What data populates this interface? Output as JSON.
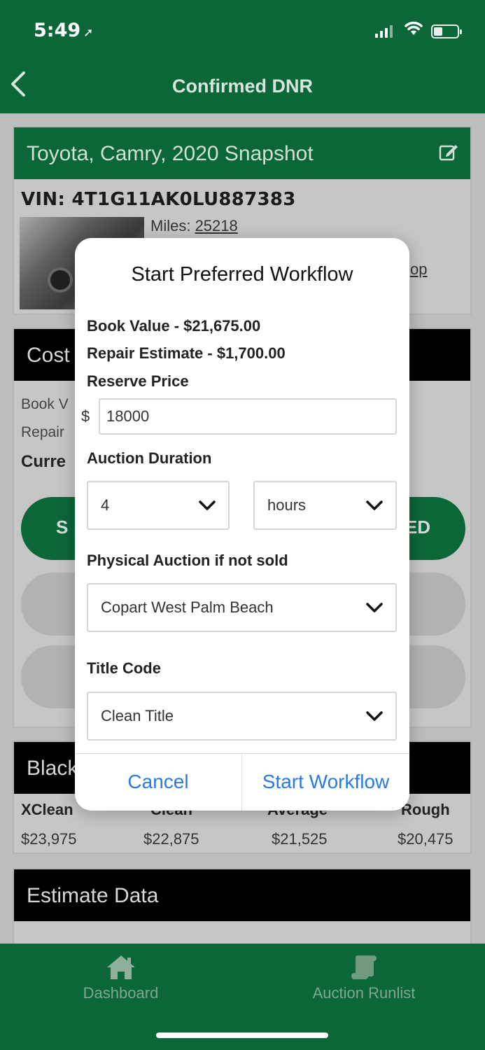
{
  "status": {
    "time": "5:49",
    "location_glyph": "➚"
  },
  "nav": {
    "title": "Confirmed DNR",
    "back_glyph": "‹"
  },
  "snapshot": {
    "title": "Toyota, Camry, 2020 Snapshot",
    "vin": "VIN: 4T1G11AK0LU887383",
    "miles_label": "Miles: ",
    "miles_value": "25218",
    "link_fragment": "op"
  },
  "cost": {
    "header": "Cost",
    "row1": "Book V",
    "row2": "Repair",
    "row3": "Curre",
    "left_button": "S",
    "right_button": "ED"
  },
  "blackbook": {
    "header": "Black",
    "columns": [
      {
        "label": "XClean",
        "value": "$23,975"
      },
      {
        "label": "Clean",
        "value": "$22,875"
      },
      {
        "label": "Average",
        "value": "$21,525"
      },
      {
        "label": "Rough",
        "value": "$20,475"
      }
    ]
  },
  "estimate": {
    "header": "Estimate Data"
  },
  "modal": {
    "title": "Start Preferred Workflow",
    "book_value": "Book Value - $21,675.00",
    "repair_estimate": "Repair Estimate - $1,700.00",
    "reserve_label": "Reserve Price",
    "currency": "$",
    "reserve_value": "18000",
    "duration_label": "Auction Duration",
    "duration_value": "4",
    "duration_unit": "hours",
    "physical_label": "Physical Auction if not sold",
    "physical_value": "Copart West Palm Beach",
    "title_code_label": "Title Code",
    "title_code_value": "Clean Title",
    "cancel": "Cancel",
    "start": "Start Workflow"
  },
  "tabs": [
    {
      "label": "Dashboard",
      "icon": "home-icon"
    },
    {
      "label": "Auction Runlist",
      "icon": "scroll-icon"
    }
  ],
  "colors": {
    "brand_green": "#0b6638",
    "link_blue": "#2a7ae2"
  }
}
